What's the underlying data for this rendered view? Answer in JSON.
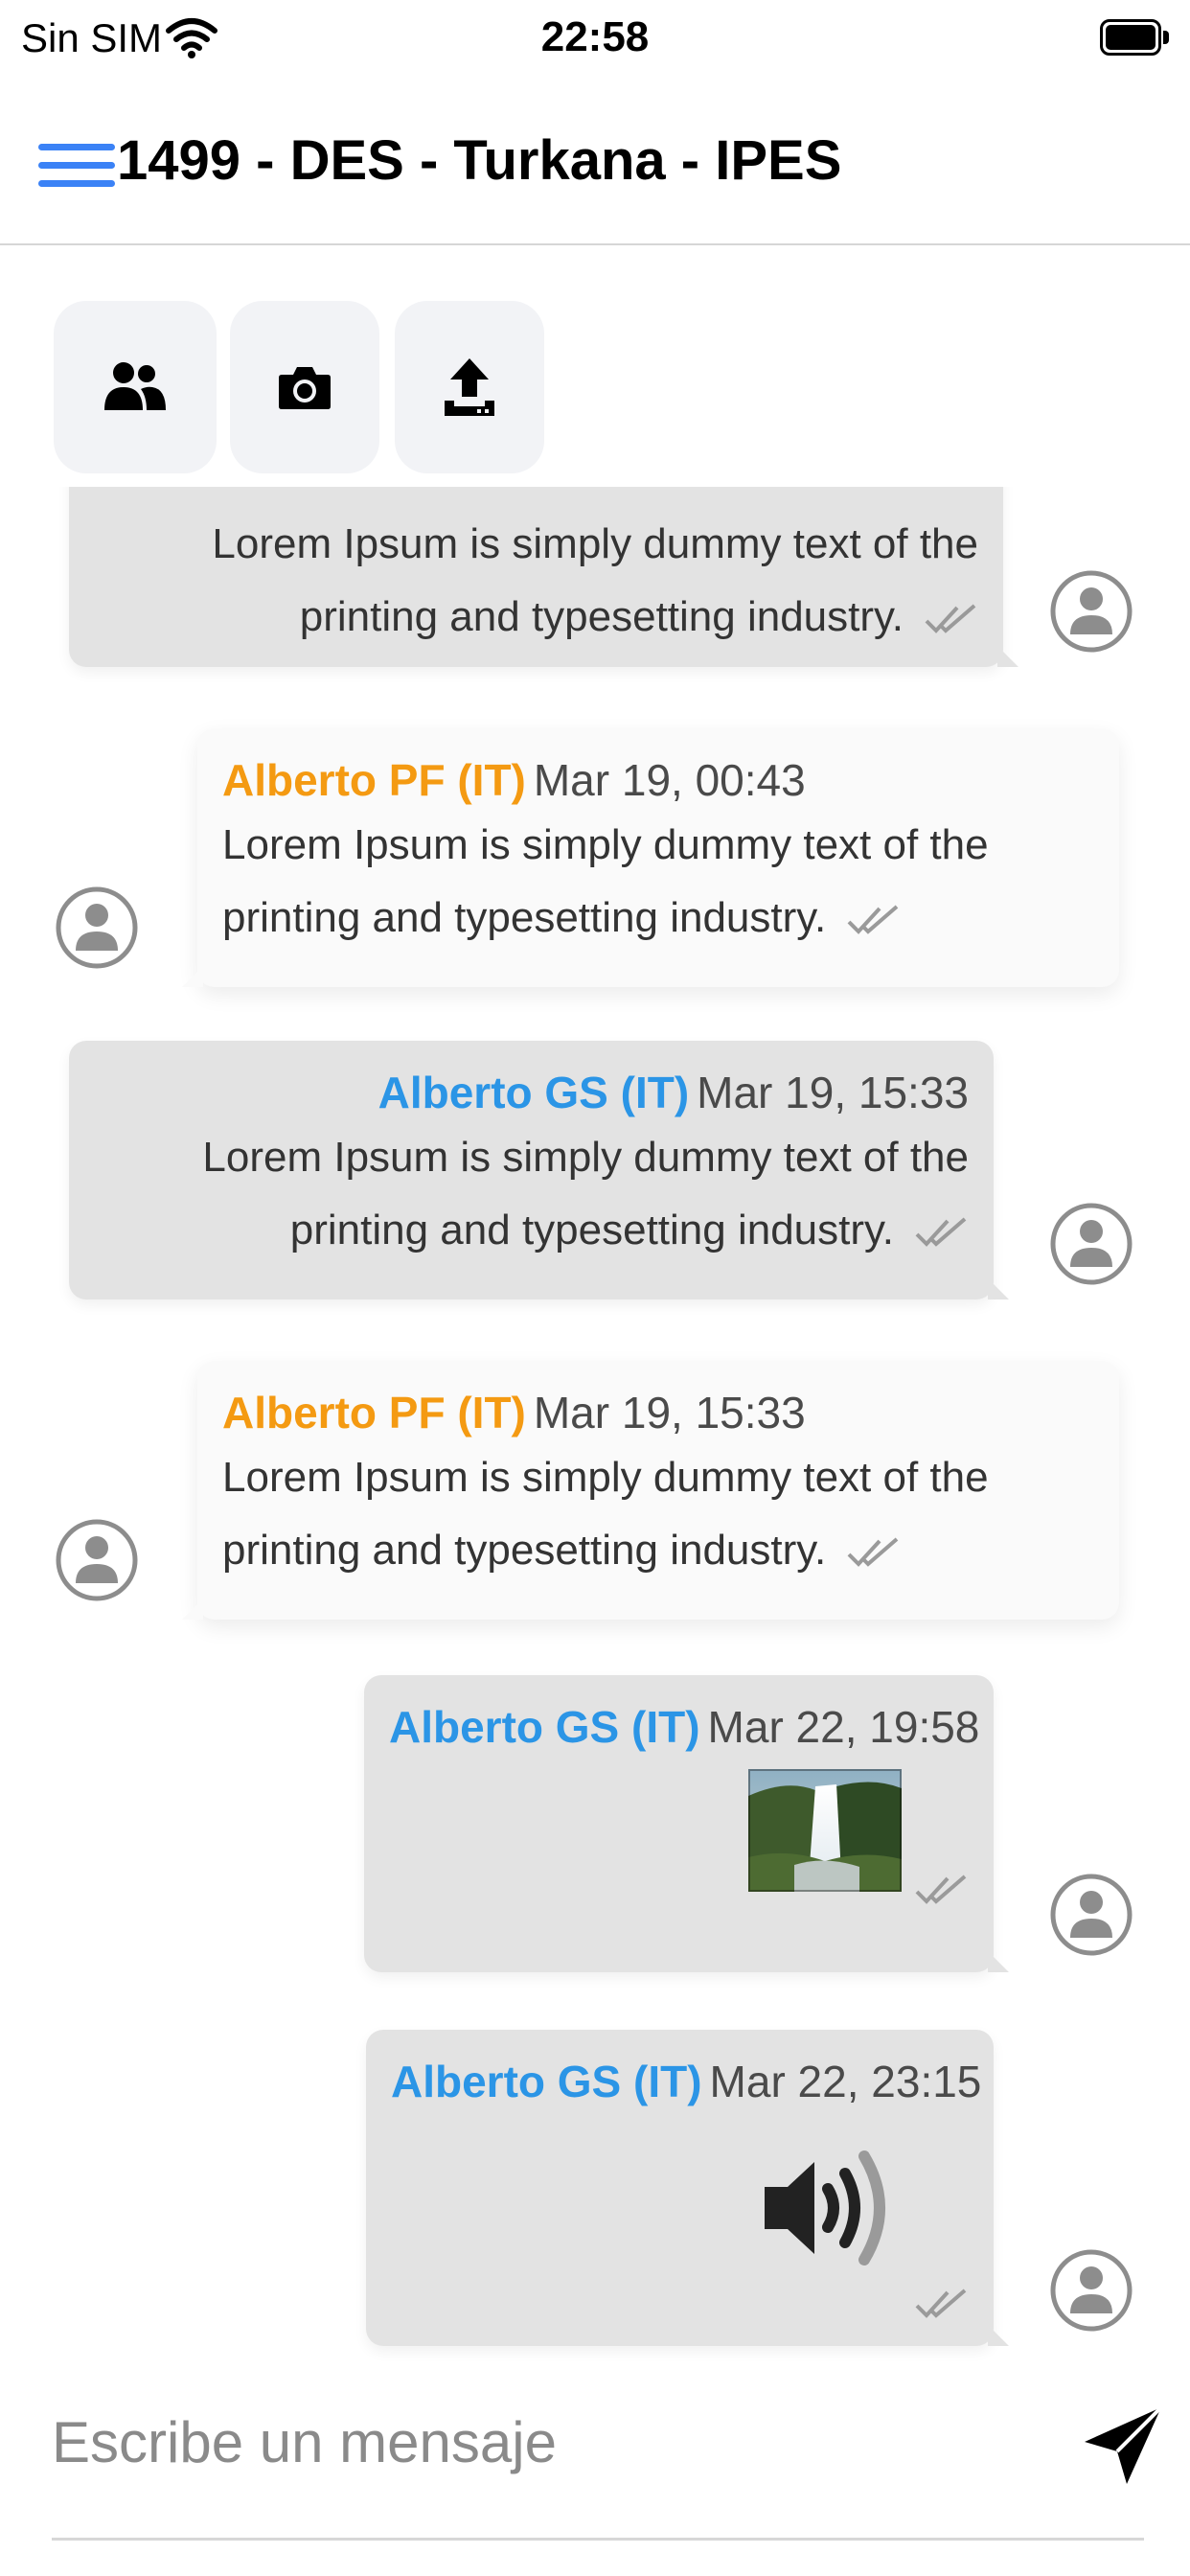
{
  "status_bar": {
    "carrier": "Sin SIM",
    "time": "22:58"
  },
  "header": {
    "title": "1499 - DES - Turkana - IPES",
    "menu_icon": "hamburger-menu-icon"
  },
  "actions": [
    {
      "icon": "group-icon"
    },
    {
      "icon": "camera-icon"
    },
    {
      "icon": "upload-icon"
    }
  ],
  "messages": [
    {
      "direction": "sent",
      "text": "Lorem Ipsum is simply dummy text of the printing and typesetting industry."
    },
    {
      "direction": "received",
      "author": "Alberto PF (IT)",
      "timestamp": "Mar 19, 00:43",
      "text": "Lorem Ipsum is simply dummy text of the printing and typesetting industry."
    },
    {
      "direction": "sent",
      "author": "Alberto GS (IT)",
      "timestamp": "Mar 19, 15:33",
      "text": "Lorem Ipsum is simply dummy text of the printing and typesetting industry."
    },
    {
      "direction": "received",
      "author": "Alberto PF (IT)",
      "timestamp": "Mar 19, 15:33",
      "text": "Lorem Ipsum is simply dummy text of the printing and typesetting industry."
    },
    {
      "direction": "sent",
      "author": "Alberto GS (IT)",
      "timestamp": "Mar 22, 19:58",
      "attachment": "image"
    },
    {
      "direction": "sent",
      "author": "Alberto GS (IT)",
      "timestamp": "Mar 22, 23:15",
      "attachment": "audio"
    }
  ],
  "composer": {
    "placeholder": "Escribe un mensaje",
    "send_icon": "send-icon"
  },
  "colors": {
    "accent_blue": "#2b95e6",
    "accent_orange": "#f49a12",
    "menu_blue": "#3b82f6",
    "sent_bubble": "#e3e3e3",
    "received_bubble": "#fafafa"
  }
}
